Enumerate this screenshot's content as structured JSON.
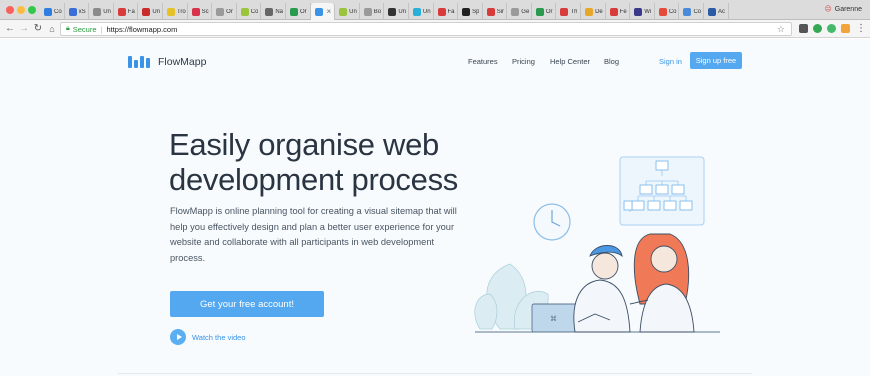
{
  "browser": {
    "tabs": [
      {
        "label": "Co",
        "color": "#2f7de1"
      },
      {
        "label": "xS",
        "color": "#3b6fd8"
      },
      {
        "label": "Un",
        "color": "#8b8b8b"
      },
      {
        "label": "Fa",
        "color": "#d83b3b"
      },
      {
        "label": "Un",
        "color": "#c92a2a"
      },
      {
        "label": "Tro",
        "color": "#e6c229"
      },
      {
        "label": "Sc",
        "color": "#d8334a"
      },
      {
        "label": "Or",
        "color": "#9a9a9a"
      },
      {
        "label": "Co",
        "color": "#9ac43c"
      },
      {
        "label": "Na",
        "color": "#666666"
      },
      {
        "label": "Or",
        "color": "#2a9b4e"
      },
      {
        "label": "",
        "color": "#3a93e6"
      },
      {
        "label": "Un",
        "color": "#9ac43c"
      },
      {
        "label": "Bo",
        "color": "#9a9a9a"
      },
      {
        "label": "Un",
        "color": "#333333"
      },
      {
        "label": "Un",
        "color": "#2ab0d8"
      },
      {
        "label": "Fa",
        "color": "#d83b3b"
      },
      {
        "label": "Sp",
        "color": "#222222"
      },
      {
        "label": "Sir",
        "color": "#d83b3b"
      },
      {
        "label": "Ge",
        "color": "#9a9a9a"
      },
      {
        "label": "Or",
        "color": "#2a9b4e"
      },
      {
        "label": "Th",
        "color": "#d83b3b"
      },
      {
        "label": "De",
        "color": "#e6a829"
      },
      {
        "label": "Fe",
        "color": "#d83b3b"
      },
      {
        "label": "Wi",
        "color": "#3a3a8a"
      },
      {
        "label": "Co",
        "color": "#e64a3b"
      },
      {
        "label": "Co",
        "color": "#4a8ad8"
      },
      {
        "label": "Ac",
        "color": "#2b5aa6"
      }
    ],
    "active_tab_index": 11,
    "profile_name": "Garenne",
    "address": {
      "secure_label": "Secure",
      "url": "https://flowmapp.com"
    },
    "icons": {
      "back": "arrow-left-icon",
      "forward": "arrow-right-icon",
      "reload": "reload-icon",
      "home": "home-icon",
      "bookmark": "star-icon"
    }
  },
  "site": {
    "brand": "FlowMapp",
    "brand_color": "#3a93e6",
    "nav": [
      "Features",
      "Pricing",
      "Help Center",
      "Blog"
    ],
    "signin": "Sign in",
    "signup": "Sign up free",
    "headline_line1": "Easily organise web",
    "headline_line2": "development process",
    "description": "FlowMapp is online planning tool for creating a visual sitemap that will help you effectively design and plan a better user experience for your website and collaborate with all participants in web development process.",
    "cta": "Get your free account!",
    "watch_video": "Watch the video",
    "accent_color": "#54a8f0"
  }
}
